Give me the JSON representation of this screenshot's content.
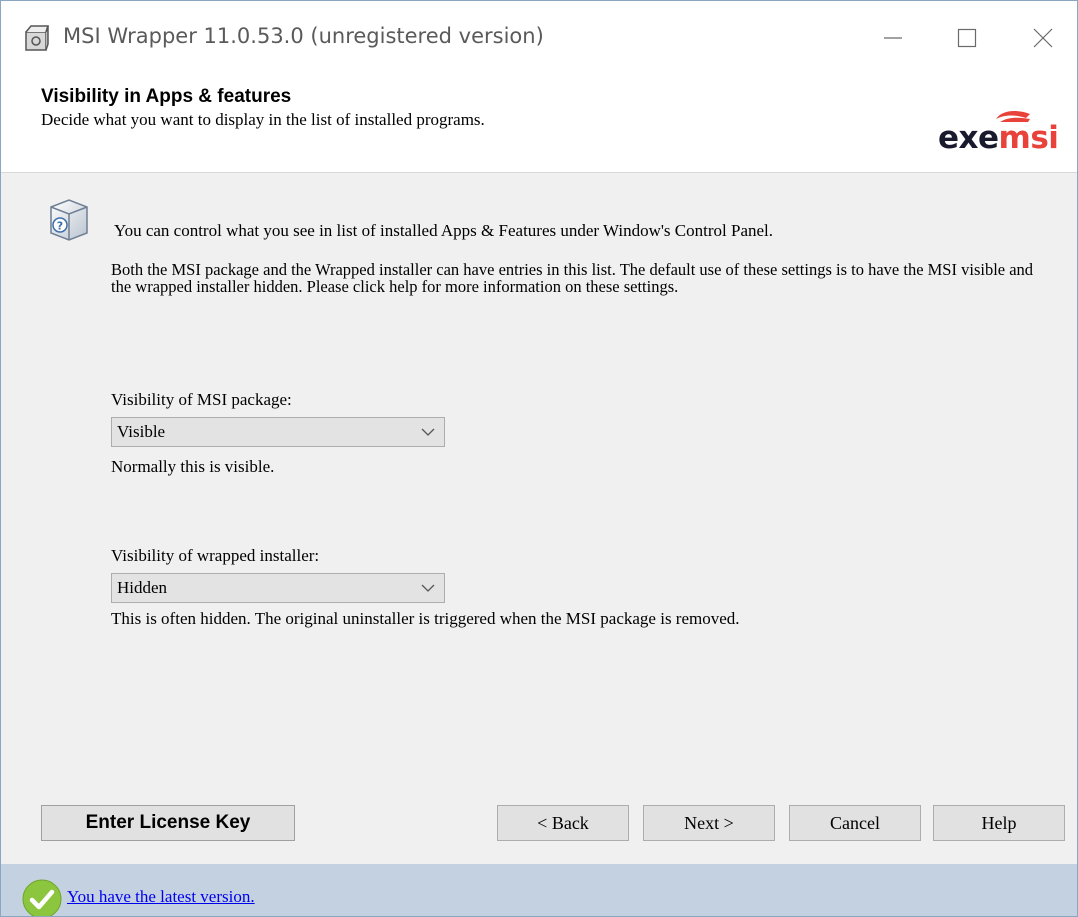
{
  "window": {
    "title": "MSI Wrapper 11.0.53.0 (unregistered version)"
  },
  "header": {
    "title": "Visibility in Apps & features",
    "subtitle": "Decide what you want to display in the list of installed programs.",
    "logo_exe": "exe",
    "logo_msi": "msi"
  },
  "content": {
    "intro": "You can control what you see in list of installed Apps & Features under Window's Control Panel.",
    "description": "Both the MSI package and the Wrapped installer can have entries in this list. The default use of these settings is to have the MSI visible and the wrapped installer hidden. Please click help for more information on these settings.",
    "msi_visibility": {
      "label": "Visibility of MSI package:",
      "value": "Visible",
      "hint": "Normally this is visible."
    },
    "wrapped_visibility": {
      "label": "Visibility of wrapped installer:",
      "value": "Hidden",
      "hint": "This is often hidden. The original uninstaller is triggered when the MSI package is removed."
    }
  },
  "buttons": {
    "license": "Enter License Key",
    "back": "< Back",
    "next": "Next >",
    "cancel": "Cancel",
    "help": "Help"
  },
  "status": {
    "link": "You have the latest version."
  },
  "colors": {
    "status_bar": "#c3d1e0",
    "logo_accent": "#e8423a",
    "link": "#0000ee"
  },
  "icons": {
    "app": "msi-wrapper-app-icon",
    "minimize": "minimize-icon",
    "maximize": "maximize-icon",
    "close": "close-icon",
    "info": "question-box-icon",
    "chevron": "chevron-down-icon",
    "status": "checkmark-icon"
  }
}
